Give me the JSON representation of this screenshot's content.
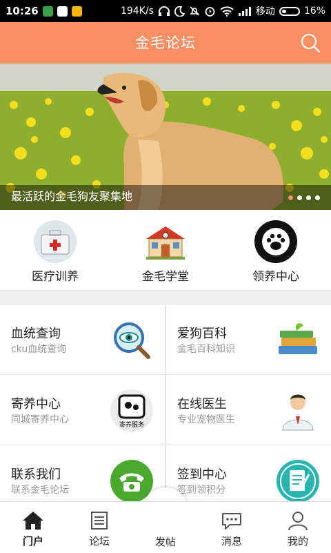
{
  "status_bar": {
    "time": "10:26",
    "speed": "194K/s",
    "carrier": "移动",
    "battery": "16%"
  },
  "header": {
    "title": "金毛论坛",
    "search_icon": "search-icon"
  },
  "banner": {
    "caption": "最活跃的金毛狗友聚集地",
    "slide_count": 4,
    "active_slide": 1
  },
  "quick_links": [
    {
      "label": "医疗训养",
      "icon": "first-aid-kit-icon"
    },
    {
      "label": "金毛学堂",
      "icon": "school-building-icon"
    },
    {
      "label": "领养中心",
      "icon": "paw-badge-icon"
    }
  ],
  "grid": [
    {
      "title": "血统查询",
      "subtitle": "cku血统查询",
      "icon": "magnifier-eye-icon"
    },
    {
      "title": "爱狗百科",
      "subtitle": "金毛百科知识",
      "icon": "books-icon"
    },
    {
      "title": "寄养中心",
      "subtitle": "同城寄养中心",
      "icon": "boarding-service-icon",
      "icon_text": "寄养服务"
    },
    {
      "title": "在线医生",
      "subtitle": "专业宠物医生",
      "icon": "doctor-icon"
    },
    {
      "title": "联系我们",
      "subtitle": "联系金毛论坛",
      "icon": "phone-icon"
    },
    {
      "title": "签到中心",
      "subtitle": "签到领积分",
      "icon": "checkin-icon"
    }
  ],
  "tabs": [
    {
      "label": "门户",
      "icon": "home-icon",
      "active": true
    },
    {
      "label": "论坛",
      "icon": "forum-scroll-icon"
    },
    {
      "label": "发帖",
      "icon": "pencil-icon"
    },
    {
      "label": "消息",
      "icon": "message-bubble-icon"
    },
    {
      "label": "我的",
      "icon": "user-icon"
    }
  ],
  "colors": {
    "accent": "#fb8e63",
    "header_text": "#ffffff"
  }
}
